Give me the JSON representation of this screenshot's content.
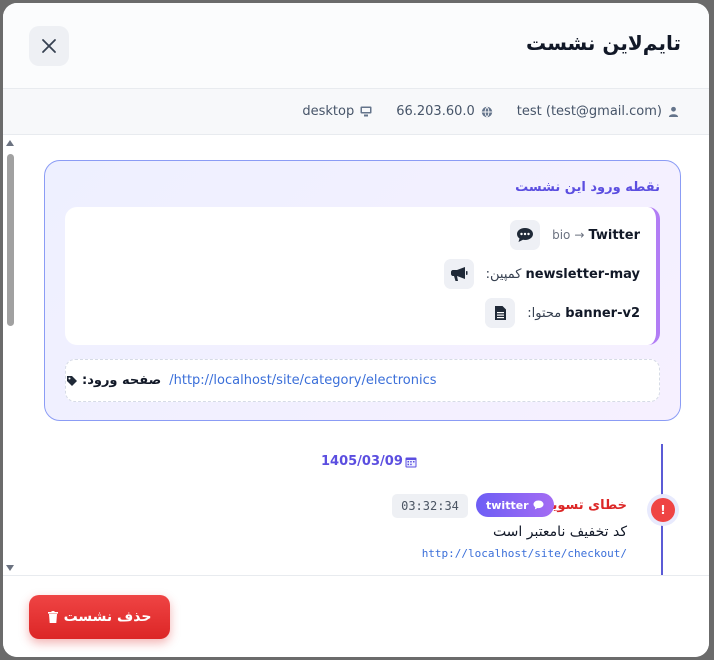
{
  "modal": {
    "title": "تایم‌لاین نشست",
    "close_icon": "close-icon"
  },
  "info": {
    "user": "test (test@gmail.com)",
    "ip": "66.203.60.0",
    "device": "desktop"
  },
  "entry": {
    "title": "نقطه ورود این نشست",
    "source_medium": "bio",
    "source_arrow": "→",
    "source_name": "Twitter",
    "campaign_label": "کمپین:",
    "campaign_value": "newsletter-may",
    "content_label": "محتوا:",
    "content_value": "banner-v2",
    "landing_label": "صفحه ورود:",
    "landing_url": "http://localhost/site/category/electronics/"
  },
  "timeline": {
    "date": "1405/03/09",
    "events": [
      {
        "title": "خطای تسویه",
        "badge": "twitter",
        "time": "03:32:34",
        "description": "کد تخفیف نامعتبر است",
        "url": "http://localhost/site/checkout/"
      }
    ]
  },
  "footer": {
    "delete_label": "حذف نشست"
  },
  "colors": {
    "accent": "#5b4ee0",
    "danger": "#dc2626",
    "link": "#3b6fd9"
  }
}
